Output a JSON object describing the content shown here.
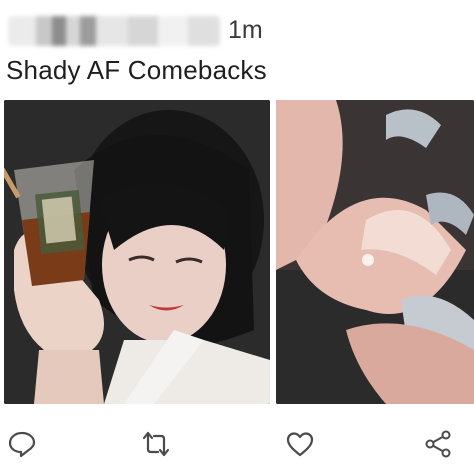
{
  "post": {
    "timestamp": "1m",
    "text": "Shady AF Comebacks"
  },
  "media": [
    {
      "description": "woman-holding-iced-drink"
    },
    {
      "description": "hand-with-long-nails"
    }
  ],
  "actions": {
    "reply": "reply-icon",
    "retweet": "retweet-icon",
    "like": "heart-icon",
    "share": "share-icon"
  },
  "colors": {
    "icon": "#4b4b4b"
  }
}
